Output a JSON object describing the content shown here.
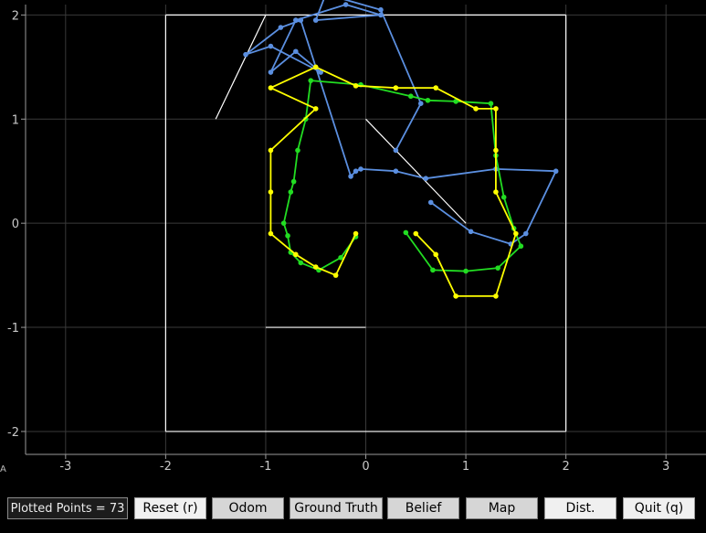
{
  "chart_data": {
    "type": "line",
    "xlim": [
      -3.4,
      3.4
    ],
    "ylim": [
      -2.22,
      2.1
    ],
    "x_ticks": [
      -3,
      -2,
      -1,
      0,
      1,
      2,
      3
    ],
    "y_ticks": [
      -2,
      -1,
      0,
      1,
      2
    ],
    "x_tick_labels": [
      "-3",
      "-2",
      "-1",
      "0",
      "1",
      "2",
      "3"
    ],
    "y_tick_labels": [
      "-2",
      "-1",
      "0",
      "1",
      "2"
    ],
    "grid": true,
    "colors": {
      "grid": "#3a3a3a",
      "axes": "#9a9a9a",
      "map": "#ffffff",
      "ground_truth": "#22dd22",
      "belief": "#ffff00",
      "odom": "#5b8fe0"
    },
    "map_segments": [
      [
        [
          -2,
          2
        ],
        [
          2,
          2
        ]
      ],
      [
        [
          2,
          2
        ],
        [
          2,
          -2
        ]
      ],
      [
        [
          2,
          -2
        ],
        [
          -2,
          -2
        ]
      ],
      [
        [
          -2,
          -2
        ],
        [
          -2,
          2
        ]
      ],
      [
        [
          -1.5,
          1
        ],
        [
          -1,
          2
        ]
      ],
      [
        [
          0,
          1
        ],
        [
          1,
          0
        ]
      ],
      [
        [
          -1,
          -1
        ],
        [
          0,
          -1
        ]
      ]
    ],
    "series": [
      {
        "key": "odom",
        "points": [
          [
            0.3,
            0.7
          ],
          [
            0.55,
            1.15
          ],
          [
            0.15,
            2.05
          ],
          [
            -0.4,
            2.2
          ],
          [
            -0.5,
            1.95
          ],
          [
            0.15,
            2.0
          ],
          [
            -0.2,
            2.1
          ],
          [
            -0.7,
            1.95
          ],
          [
            -0.95,
            1.45
          ],
          [
            -0.7,
            1.65
          ],
          [
            -0.45,
            1.45
          ],
          [
            -0.95,
            1.7
          ],
          [
            -1.2,
            1.62
          ],
          [
            -0.85,
            1.88
          ],
          [
            -0.65,
            1.95
          ],
          [
            -0.15,
            0.45
          ],
          [
            -0.1,
            0.5
          ],
          [
            -0.05,
            0.52
          ],
          [
            0.3,
            0.5
          ],
          [
            0.6,
            0.43
          ],
          [
            1.3,
            0.52
          ],
          [
            1.9,
            0.5
          ],
          [
            1.6,
            -0.1
          ],
          [
            1.45,
            -0.2
          ],
          [
            1.05,
            -0.08
          ],
          [
            0.65,
            0.2
          ]
        ]
      },
      {
        "key": "ground_truth",
        "points": [
          [
            -0.1,
            -0.13
          ],
          [
            -0.25,
            -0.33
          ],
          [
            -0.47,
            -0.45
          ],
          [
            -0.65,
            -0.38
          ],
          [
            -0.75,
            -0.28
          ],
          [
            -0.78,
            -0.12
          ],
          [
            -0.82,
            0.0
          ],
          [
            -0.75,
            0.3
          ],
          [
            -0.72,
            0.4
          ],
          [
            -0.68,
            0.7
          ],
          [
            -0.6,
            1.0
          ],
          [
            -0.55,
            1.37
          ],
          [
            -0.05,
            1.33
          ],
          [
            0.45,
            1.22
          ],
          [
            0.62,
            1.18
          ],
          [
            0.9,
            1.17
          ],
          [
            1.25,
            1.15
          ],
          [
            1.3,
            0.65
          ],
          [
            1.38,
            0.25
          ],
          [
            1.48,
            -0.05
          ],
          [
            1.55,
            -0.22
          ],
          [
            1.32,
            -0.43
          ],
          [
            1.0,
            -0.46
          ],
          [
            0.67,
            -0.45
          ],
          [
            0.4,
            -0.09
          ]
        ]
      },
      {
        "key": "belief",
        "points": [
          [
            -0.1,
            -0.1
          ],
          [
            -0.3,
            -0.5
          ],
          [
            -0.5,
            -0.42
          ],
          [
            -0.7,
            -0.3
          ],
          [
            -0.95,
            -0.1
          ],
          [
            -0.95,
            0.3
          ],
          [
            -0.95,
            0.7
          ],
          [
            -0.5,
            1.1
          ],
          [
            -0.95,
            1.3
          ],
          [
            -0.5,
            1.5
          ],
          [
            -0.1,
            1.32
          ],
          [
            0.3,
            1.3
          ],
          [
            0.7,
            1.3
          ],
          [
            1.1,
            1.1
          ],
          [
            1.3,
            1.1
          ],
          [
            1.3,
            0.7
          ],
          [
            1.3,
            0.3
          ],
          [
            1.5,
            -0.1
          ],
          [
            1.3,
            -0.7
          ],
          [
            0.9,
            -0.7
          ],
          [
            0.7,
            -0.3
          ],
          [
            0.5,
            -0.1
          ]
        ]
      }
    ]
  },
  "toolbar": {
    "status": "Plotted Points = 73",
    "buttons": [
      {
        "label": "Reset (r)",
        "active": false
      },
      {
        "label": "Odom",
        "active": true
      },
      {
        "label": "Ground Truth",
        "active": true
      },
      {
        "label": "Belief",
        "active": true
      },
      {
        "label": "Map",
        "active": true
      },
      {
        "label": "Dist.",
        "active": false
      },
      {
        "label": "Quit (q)",
        "active": false
      }
    ]
  }
}
